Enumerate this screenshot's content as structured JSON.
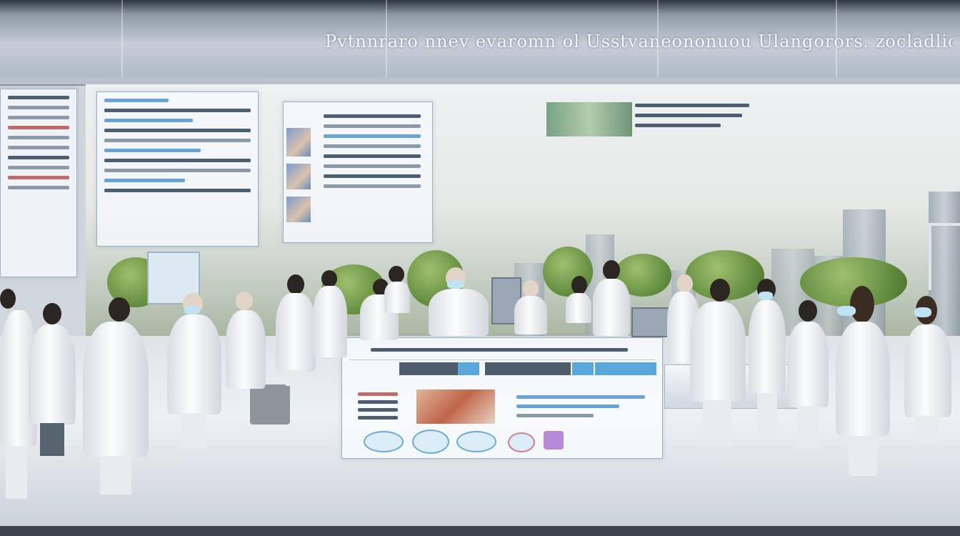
{
  "scene": {
    "description_free": true,
    "banner_text": "Pvtnnraro nnev evaromn ol Usstvaneononuou Ulangorors. zocladlion"
  },
  "colors": {
    "ceiling": "#aeb9c6",
    "coat": "#fbfcfd",
    "sky": "#eef1f3",
    "foliage": "#5f8a3c"
  }
}
